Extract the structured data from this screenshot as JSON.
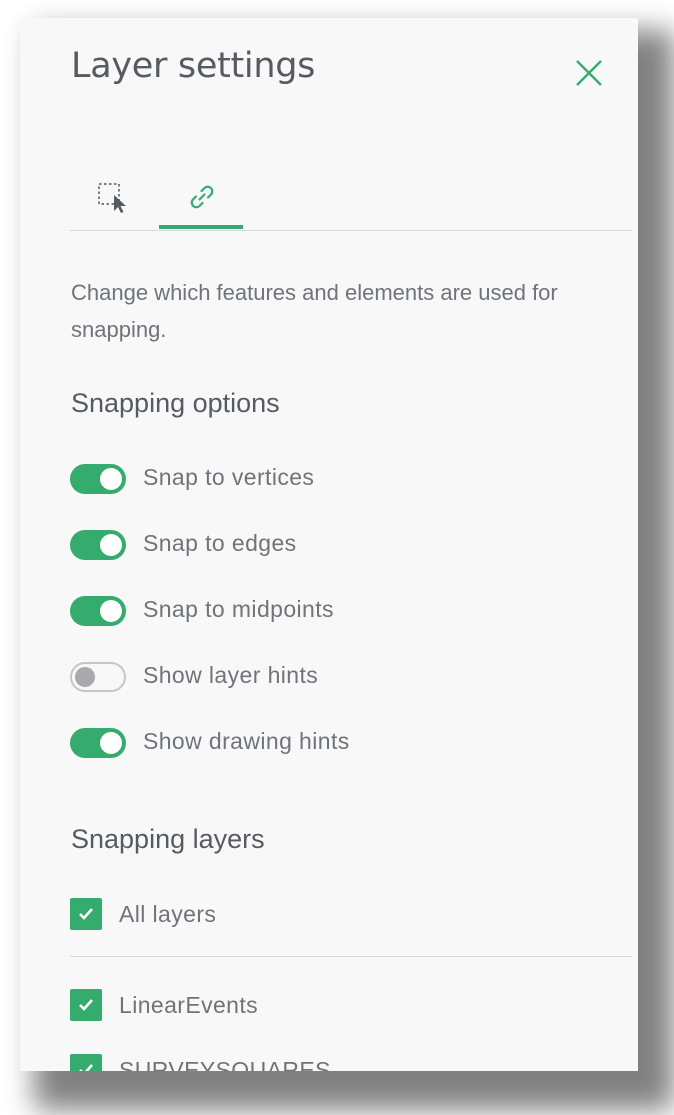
{
  "panel": {
    "title": "Layer settings",
    "close_icon": "close-icon"
  },
  "tabs": [
    {
      "icon": "select-cursor-icon",
      "active": false
    },
    {
      "icon": "link-icon",
      "active": true
    }
  ],
  "description": "Change which features and elements are used for snapping.",
  "snapping_options": {
    "heading": "Snapping options",
    "items": [
      {
        "label": "Snap to vertices",
        "enabled": true
      },
      {
        "label": "Snap to edges",
        "enabled": true
      },
      {
        "label": "Snap to midpoints",
        "enabled": true
      },
      {
        "label": "Show layer hints",
        "enabled": false
      },
      {
        "label": "Show drawing hints",
        "enabled": true
      }
    ]
  },
  "snapping_layers": {
    "heading": "Snapping layers",
    "all_layers": {
      "label": "All layers",
      "checked": true
    },
    "layers": [
      {
        "label": "LinearEvents",
        "checked": true
      },
      {
        "label": "SURVEYSQUARES",
        "checked": true
      }
    ]
  },
  "colors": {
    "accent": "#35ac6e",
    "text": "#6e747a",
    "heading": "#555b61",
    "panel_bg": "#f8f8f8"
  }
}
